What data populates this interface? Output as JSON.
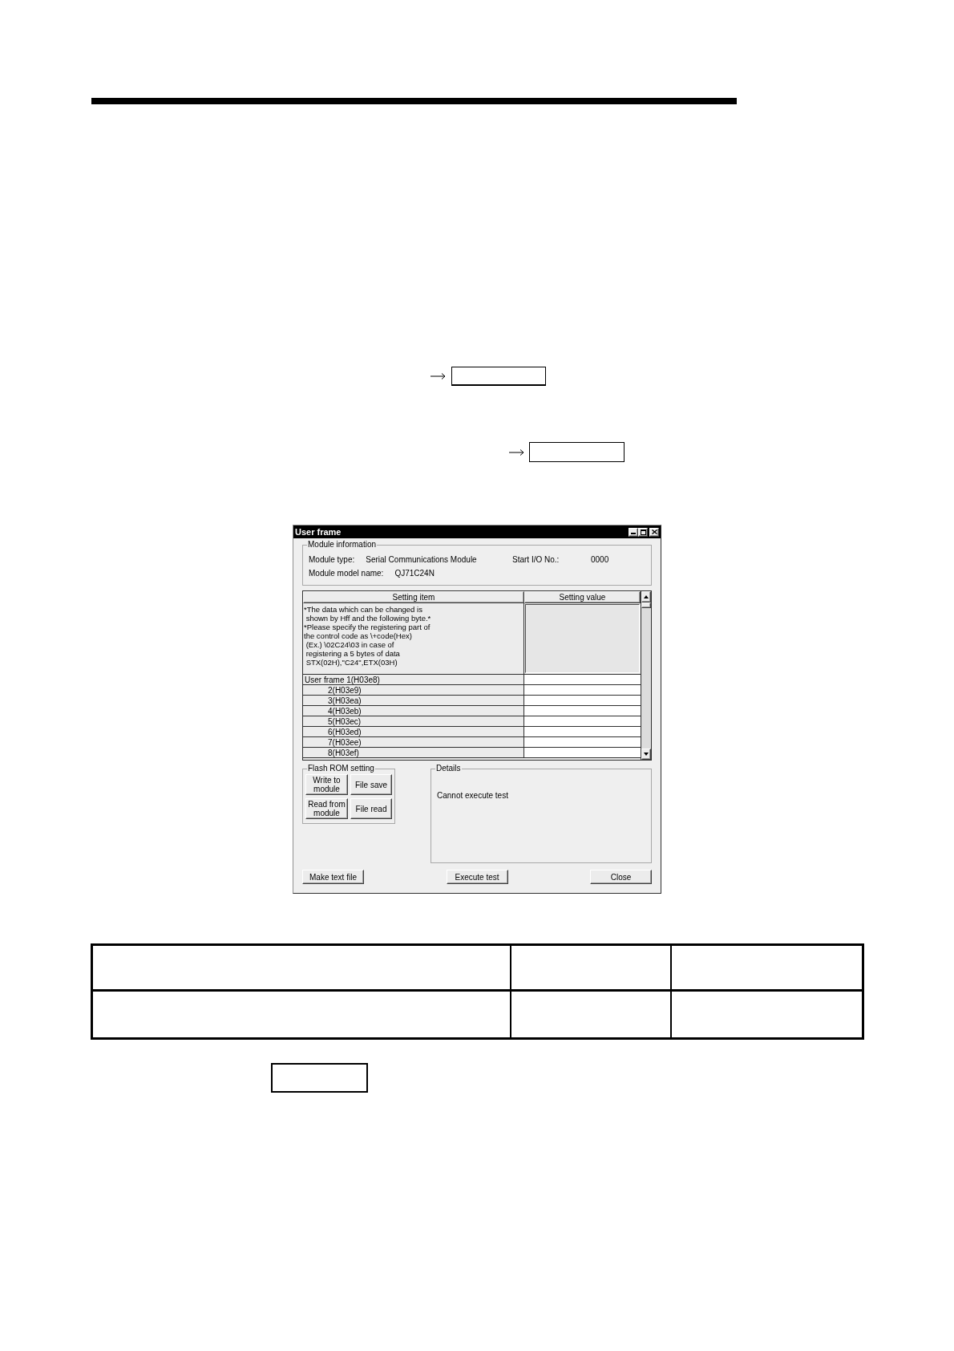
{
  "window": {
    "title": "User frame"
  },
  "module_information": {
    "title": "Module information",
    "rows": [
      [
        {
          "label": "Module type:",
          "value": "Serial Communications Module"
        },
        {
          "label": "Start I/O No.:",
          "value": "0000"
        }
      ],
      [
        {
          "label": "Module model name:",
          "value": "QJ71C24N"
        }
      ]
    ]
  },
  "settings_table": {
    "columns": [
      "Setting item",
      "Setting value"
    ],
    "note": "*The data which can be changed is\n shown by Hff and the following byte.*\n*Please specify the registering part of\nthe control code as \\+code(Hex)\n (Ex.) \\02C24\\03 in case of\n registering a 5 bytes of data\n STX(02H),\"C24\",ETX(03H)",
    "rows": [
      "User frame 1(H03e8)",
      "2(H03e9)",
      "3(H03ea)",
      "4(H03eb)",
      "5(H03ec)",
      "6(H03ed)",
      "7(H03ee)",
      "8(H03ef)"
    ]
  },
  "flash_rom_setting": {
    "title": "Flash ROM setting",
    "buttons": [
      "Write to module",
      "File save",
      "Read from module",
      "File read"
    ]
  },
  "details": {
    "title": "Details",
    "message": "Cannot execute test"
  },
  "buttons": [
    "Make text file",
    "Execute test",
    "Close"
  ]
}
